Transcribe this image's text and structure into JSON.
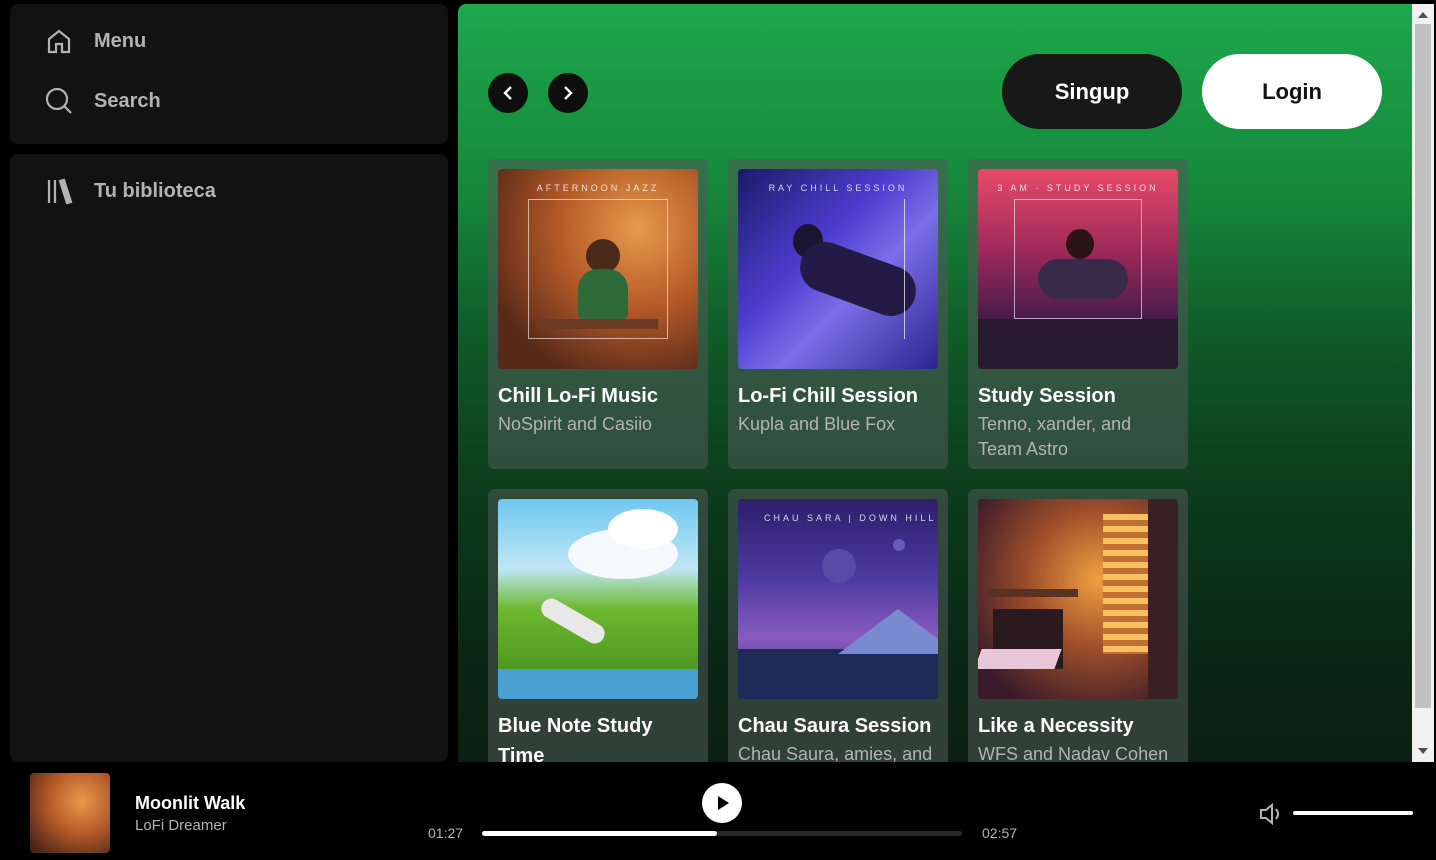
{
  "sidebar": {
    "menu_label": "Menu",
    "search_label": "Search",
    "library_label": "Tu biblioteca"
  },
  "header": {
    "signup_label": "Singup",
    "login_label": "Login"
  },
  "cards": [
    {
      "title": "Chill Lo-Fi Music",
      "subtitle": "NoSpirit and Casiio",
      "cover_text": "AFTERNOON JAZZ"
    },
    {
      "title": "Lo-Fi Chill Session",
      "subtitle": "Kupla and Blue Fox",
      "cover_text": "RAY CHILL SESSION"
    },
    {
      "title": "Study Session",
      "subtitle": "Tenno, xander, and Team Astro",
      "cover_text": "3 AM · STUDY SESSION"
    },
    {
      "title": "Blue Note Study Time",
      "subtitle": "",
      "cover_text": ""
    },
    {
      "title": "Chau Saura Session",
      "subtitle": "Chau Saura, amies, and",
      "cover_text": "CHAU SARA | DOWN HILL"
    },
    {
      "title": "Like a Necessity",
      "subtitle": "WFS and Nadav Cohen",
      "cover_text": ""
    }
  ],
  "player": {
    "track_title": "Moonlit Walk",
    "track_artist": "LoFi Dreamer",
    "elapsed": "01:27",
    "duration": "02:57",
    "progress_fraction": 0.49,
    "volume_fraction": 1.0
  },
  "colors": {
    "accent_green": "#1da84c",
    "sidebar_bg": "#121212"
  }
}
